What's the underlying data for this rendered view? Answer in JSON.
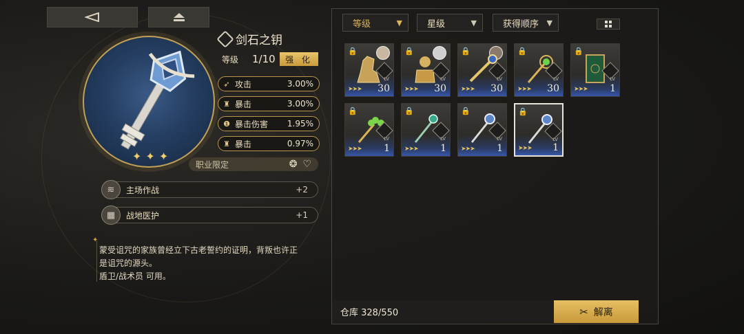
{
  "top": {
    "back_icon": "back-arrow-icon",
    "home_icon": "eject-icon"
  },
  "item": {
    "name": "剑石之钥",
    "level_label": "等级",
    "level_value": "1/10",
    "enhance_label": "强 化",
    "stats": [
      {
        "icon": "attack-icon",
        "name": "攻击",
        "value": "3.00%"
      },
      {
        "icon": "crit-icon",
        "name": "暴击",
        "value": "3.00%"
      },
      {
        "icon": "crit-damage-icon",
        "name": "暴击伤害",
        "value": "1.95%"
      },
      {
        "icon": "crit-icon",
        "name": "暴击",
        "value": "0.97%"
      }
    ],
    "job_label": "职业限定",
    "skills": [
      {
        "icon": "wind-icon",
        "name": "主场作战",
        "value": "+2"
      },
      {
        "icon": "brick-icon",
        "name": "战地医护",
        "value": "+1"
      }
    ],
    "description_lines": [
      "蒙受诅咒的家族曾经立下古老誓约的证明，背叛也许正",
      "是诅咒的源头。",
      "盾卫/战术员 可用。"
    ]
  },
  "filters": [
    {
      "label": "等级",
      "active": true
    },
    {
      "label": "星级",
      "active": false
    },
    {
      "label": "获得顺序",
      "active": false
    }
  ],
  "inventory": [
    {
      "item": "golden-lion-statue",
      "level": "30",
      "stars": 3,
      "avatar": true,
      "lv_label": "LV"
    },
    {
      "item": "golden-bust",
      "level": "30",
      "stars": 3,
      "avatar": true,
      "lv_label": "LV"
    },
    {
      "item": "golden-key",
      "level": "30",
      "stars": 3,
      "avatar": true,
      "lv_label": "LV"
    },
    {
      "item": "green-orb-key",
      "level": "30",
      "stars": 3,
      "avatar": false,
      "lv_label": "LV"
    },
    {
      "item": "green-book",
      "level": "1",
      "stars": 3,
      "avatar": false,
      "lv_label": "LV"
    },
    {
      "item": "clover-key",
      "level": "1",
      "stars": 3,
      "avatar": false,
      "lv_label": "LV"
    },
    {
      "item": "jade-key",
      "level": "1",
      "stars": 3,
      "avatar": false,
      "lv_label": "LV"
    },
    {
      "item": "silver-key",
      "level": "1",
      "stars": 3,
      "avatar": false,
      "lv_label": "LV"
    },
    {
      "item": "silver-key-selected",
      "level": "1",
      "stars": 3,
      "avatar": false,
      "lv_label": "LV",
      "selected": true
    }
  ],
  "storage_label": "仓库 328/550",
  "release_label": "解离"
}
